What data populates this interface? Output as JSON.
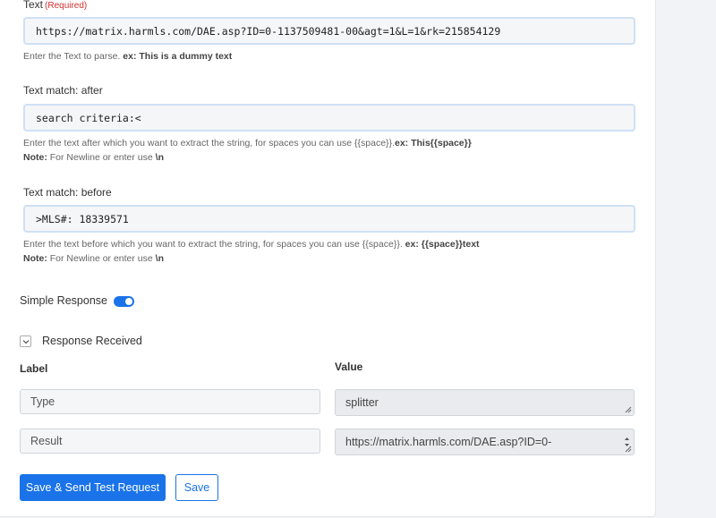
{
  "text_field": {
    "label": "Text",
    "required": "(Required)",
    "value": "https://matrix.harmls.com/DAE.asp?ID=0-1137509481-00&agt=1&L=1&rk=215854129",
    "help_prefix": "Enter the Text to parse. ",
    "help_example": "ex: This is a dummy text"
  },
  "after_field": {
    "label": "Text match: after",
    "value": "search criteria:<",
    "help_prefix": "Enter the text after which you want to extract the string, for spaces you can use {{space}}.",
    "help_example": "ex: This{{space}}",
    "note_label": "Note:",
    "note_text": " For Newline or enter use ",
    "note_code": "\\n"
  },
  "before_field": {
    "label": "Text match: before",
    "value": ">MLS#: 18339571",
    "help_prefix": "Enter the text before which you want to extract the string, for spaces you can use {{space}}. ",
    "help_example": "ex: {{space}}text",
    "note_label": "Note:",
    "note_text": " For Newline or enter use ",
    "note_code": "\\n"
  },
  "simple_response": {
    "label": "Simple Response",
    "enabled": true
  },
  "response_received": {
    "label": "Response Received",
    "col_label": "Label",
    "col_value": "Value",
    "rows": [
      {
        "label": "Type",
        "value": "splitter"
      },
      {
        "label": "Result",
        "value": "https://matrix.harmls.com/DAE.asp?ID=0-"
      }
    ]
  },
  "buttons": {
    "save_send": "Save & Send Test Request",
    "save": "Save"
  },
  "colors": {
    "accent": "#1a73e8",
    "required": "#d32f2f"
  }
}
